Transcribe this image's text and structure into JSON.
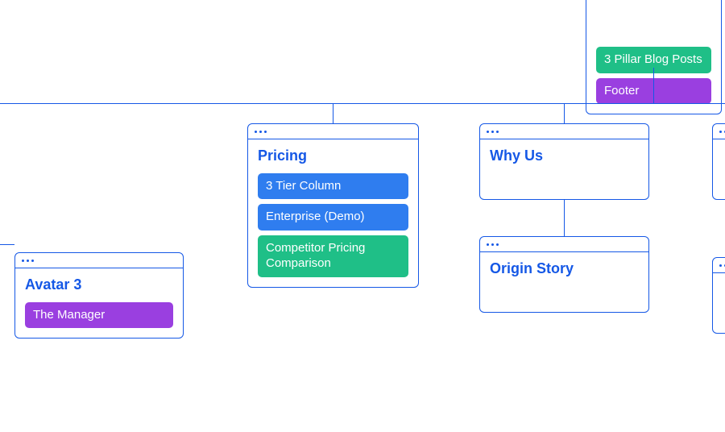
{
  "colors": {
    "stroke": "#1558e6",
    "blue": "#2f7def",
    "green": "#1fbf87",
    "purple": "#9a3fe0"
  },
  "topCard": {
    "pills": [
      {
        "label": "3 Pillar Blog Posts",
        "color": "green"
      },
      {
        "label": "Footer",
        "color": "purple"
      }
    ]
  },
  "cards": {
    "avatar3": {
      "title": "Avatar 3",
      "pills": [
        {
          "label": "The Manager",
          "color": "purple"
        }
      ]
    },
    "pricing": {
      "title": "Pricing",
      "pills": [
        {
          "label": "3 Tier Column",
          "color": "blue"
        },
        {
          "label": "Enterprise (Demo)",
          "color": "blue"
        },
        {
          "label": "Competitor Pricing Comparison",
          "color": "green"
        }
      ]
    },
    "whyus": {
      "title": "Why Us",
      "pills": []
    },
    "origin": {
      "title": "Origin Story",
      "pills": []
    }
  }
}
